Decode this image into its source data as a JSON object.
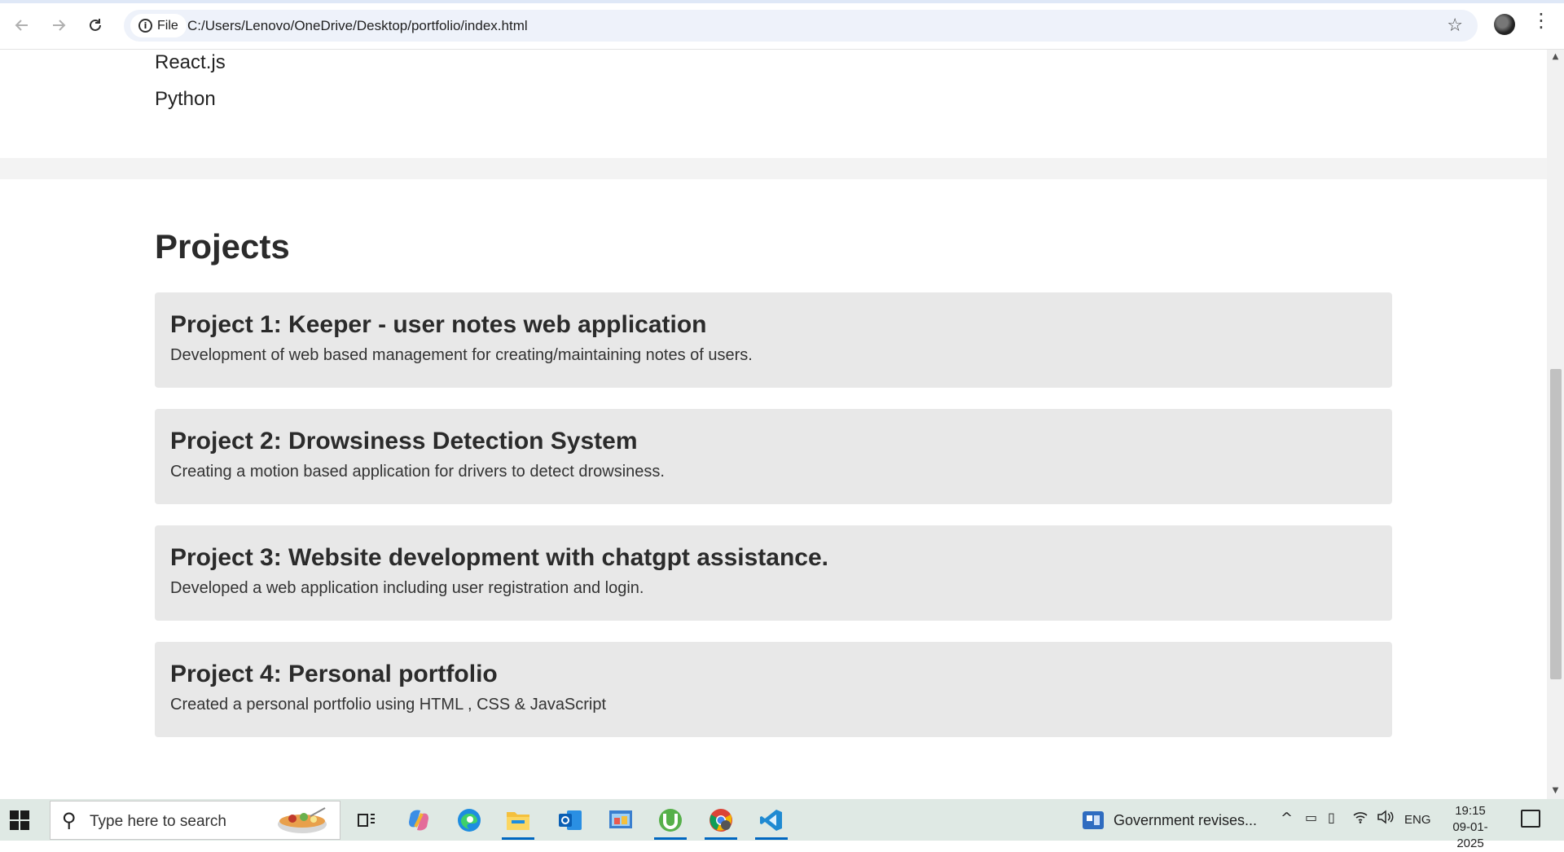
{
  "browser": {
    "chip_label": "File",
    "url": "C:/Users/Lenovo/OneDrive/Desktop/portfolio/index.html"
  },
  "page": {
    "skills": [
      "React.js",
      "Python"
    ],
    "projects_heading": "Projects",
    "projects": [
      {
        "title": "Project 1: Keeper - user notes web application",
        "description": "Development of web based management for creating/maintaining notes of users."
      },
      {
        "title": "Project 2: Drowsiness Detection System",
        "description": "Creating a motion based application for drivers to detect drowsiness."
      },
      {
        "title": "Project 3: Website development with chatgpt assistance.",
        "description": "Developed a web application including user registration and login."
      },
      {
        "title": "Project 4: Personal portfolio",
        "description": "Created a personal portfolio using HTML , CSS & JavaScript"
      }
    ]
  },
  "taskbar": {
    "search_placeholder": "Type here to search",
    "news_text": "Government revises...",
    "language": "ENG",
    "time": "19:15",
    "date": "09-01-2025"
  },
  "icons": [
    "back-icon",
    "forward-icon",
    "reload-icon",
    "info-icon",
    "star-icon",
    "profile-icon",
    "menu-icon",
    "windows-icon",
    "search-icon",
    "task-view-icon",
    "copilot-icon",
    "edge-icon",
    "file-explorer-icon",
    "outlook-icon",
    "control-panel-icon",
    "utorrent-icon",
    "chrome-icon",
    "vscode-icon",
    "news-icon"
  ]
}
